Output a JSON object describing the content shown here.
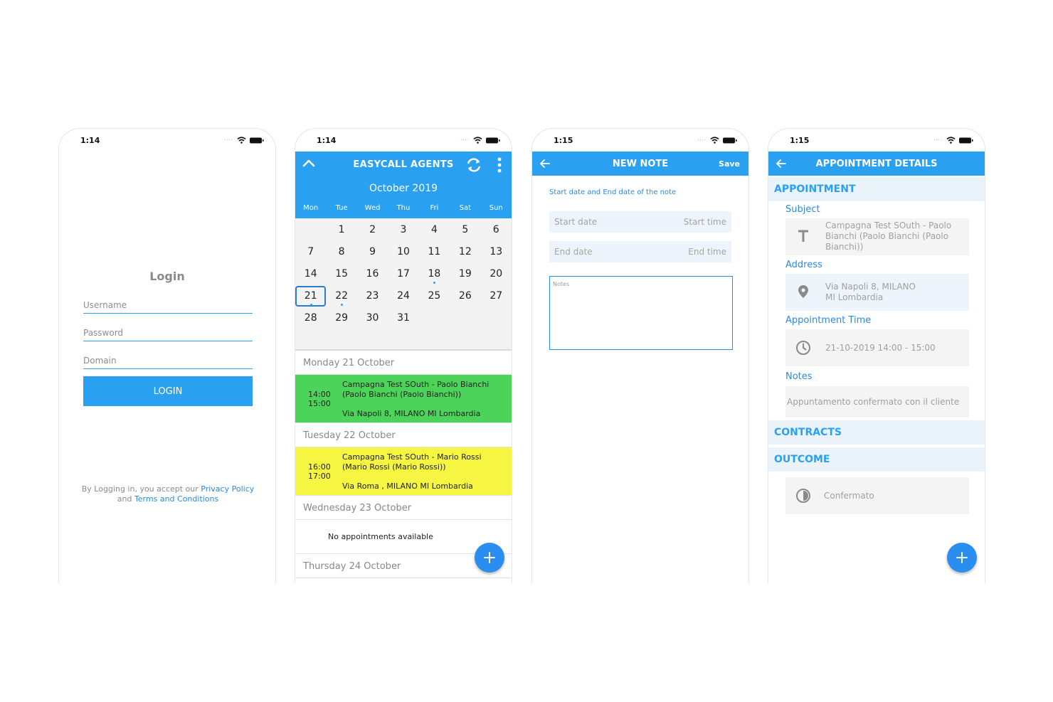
{
  "login_screen": {
    "status_time": "1:14",
    "title": "Login",
    "username_placeholder": "Username",
    "password_placeholder": "Password",
    "domain_placeholder": "Domain",
    "login_button": "LOGIN",
    "legal_prefix": "By Logging in, you accept our",
    "privacy_link": "Privacy Policy",
    "legal_and": "and",
    "terms_link": "Terms and Conditions"
  },
  "calendar_screen": {
    "status_time": "1:14",
    "app_title": "EASYCALL AGENTS",
    "month_label": "October 2019",
    "weekdays": [
      "Mon",
      "Tue",
      "Wed",
      "Thu",
      "Fri",
      "Sat",
      "Sun"
    ],
    "weeks": [
      [
        "",
        "1",
        "2",
        "3",
        "4",
        "5",
        "6"
      ],
      [
        "7",
        "8",
        "9",
        "10",
        "11",
        "12",
        "13"
      ],
      [
        "14",
        "15",
        "16",
        "17",
        "18",
        "19",
        "20"
      ],
      [
        "21",
        "22",
        "23",
        "24",
        "25",
        "26",
        "27"
      ],
      [
        "28",
        "29",
        "30",
        "31",
        "",
        "",
        ""
      ]
    ],
    "selected_day": "21",
    "event_dot_days": [
      "18",
      "21",
      "22"
    ],
    "agenda": [
      {
        "kind": "header",
        "text": "Monday 21 October"
      },
      {
        "kind": "appointment",
        "color": "#4cd35a",
        "start": "14:00",
        "end": "15:00",
        "subject_line1": "Campagna Test SOuth - Paolo Bianchi",
        "subject_line2": "(Paolo Bianchi (Paolo Bianchi))",
        "address": "Via Napoli 8,  MILANO MI Lombardia"
      },
      {
        "kind": "header",
        "text": "Tuesday 22 October"
      },
      {
        "kind": "appointment",
        "color": "#f5f542",
        "start": "16:00",
        "end": "17:00",
        "subject_line1": "Campagna Test SOuth - Mario Rossi",
        "subject_line2": "(Mario Rossi (Mario Rossi))",
        "address": "Via Roma ,  MILANO MI Lombardia"
      },
      {
        "kind": "header",
        "text": "Wednesday 23 October"
      },
      {
        "kind": "empty",
        "text": "No appointments available"
      },
      {
        "kind": "header",
        "text": "Thursday 24 October"
      }
    ]
  },
  "new_note_screen": {
    "status_time": "1:15",
    "title": "NEW NOTE",
    "save_label": "Save",
    "hint": "Start date and End date of the note",
    "start_date_placeholder": "Start date",
    "start_time_placeholder": "Start time",
    "end_date_placeholder": "End date",
    "end_time_placeholder": "End time",
    "notes_placeholder": "Notes"
  },
  "details_screen": {
    "status_time": "1:15",
    "title": "APPOINTMENT DETAILS",
    "section_appointment": "APPOINTMENT",
    "subject_label": "Subject",
    "subject_value": "Campagna Test SOuth - Paolo Bianchi (Paolo Bianchi (Paolo Bianchi))",
    "address_label": "Address",
    "address_line1": "Via Napoli 8,  MILANO",
    "address_line2": "MI Lombardia",
    "time_label": "Appointment Time",
    "time_value": "21-10-2019 14:00 - 15:00",
    "notes_label": "Notes",
    "notes_value": "Appuntamento confermato con il cliente",
    "section_contracts": "CONTRACTS",
    "section_outcome": "OUTCOME",
    "outcome_value": "Confermato"
  },
  "colors": {
    "primary": "#2aa0f0",
    "fab": "#2a8ef0",
    "appointment_green": "#4cd35a",
    "appointment_yellow": "#f5f542"
  }
}
